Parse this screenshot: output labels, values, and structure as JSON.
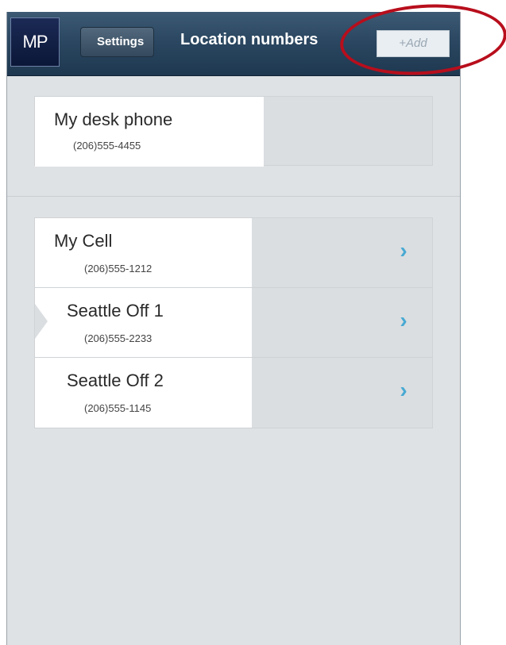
{
  "header": {
    "logo_text": "MP",
    "back_label": "Settings",
    "title": "Location numbers",
    "add_label": "+Add"
  },
  "sections": [
    {
      "items": [
        {
          "name": "My desk phone",
          "number": "(206)555-4455"
        }
      ]
    },
    {
      "items": [
        {
          "name": "My Cell",
          "number": "(206)555-1212"
        },
        {
          "name": "Seattle Off 1",
          "number": "(206)555-2233"
        },
        {
          "name": "Seattle Off 2",
          "number": "(206)555-1145"
        }
      ]
    }
  ],
  "colors": {
    "header": "#2b4761",
    "accent_chevron": "#48a9d2",
    "annotation": "#b80e1c",
    "background": "#dfe2e4"
  },
  "icons": {
    "chevron": "chevron-right-icon",
    "back": "back-arrow-icon"
  }
}
